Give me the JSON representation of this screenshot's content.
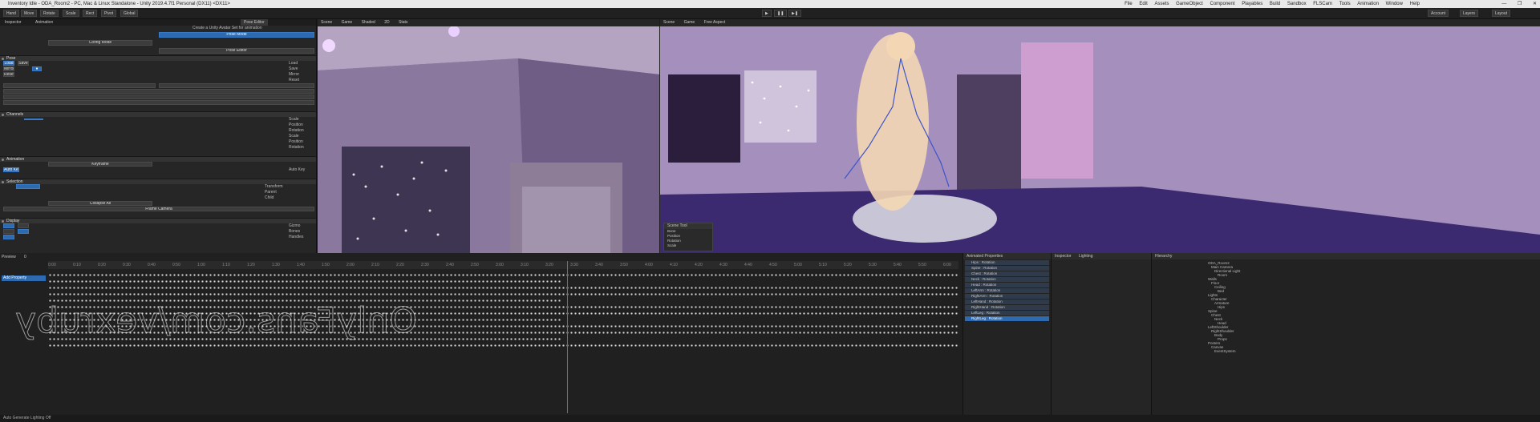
{
  "title_bar": {
    "title": "Inventory Idle - ODA_Room2 - PC, Mac & Linux Standalone - Unity 2019.4.7f1 Personal (DX11) <DX11>",
    "menus": [
      "File",
      "Edit",
      "Assets",
      "GameObject",
      "Component",
      "Playables",
      "Build",
      "Sandbox",
      "FLSCam",
      "Tools",
      "Animation",
      "Window",
      "Help"
    ],
    "window_controls": [
      "—",
      "❐",
      "✕"
    ]
  },
  "toolbar": {
    "tools": [
      "Hand",
      "Move",
      "Rotate",
      "Scale",
      "Rect"
    ],
    "pivot": "Pivot",
    "space": "Global",
    "account": "Account",
    "layers": "Layers",
    "layout": "Layout"
  },
  "left_panel": {
    "tabs": [
      "Inspector",
      "Animation",
      "Pose Editor"
    ],
    "header": "Create a Unity Avatar Set for animation",
    "buttons": [
      "Pose Mode",
      "Config Mode"
    ],
    "sections": [
      {
        "title": "Pose",
        "rows": [
          "Load",
          "Save",
          "Mirror",
          "Reset"
        ]
      },
      {
        "title": "Channels",
        "rows": [
          "Scale",
          "Position",
          "Rotation"
        ]
      },
      {
        "title": "Animation",
        "rows": [
          "Keyframe",
          "Auto Key"
        ]
      },
      {
        "title": "Selection",
        "rows": [
          "Transform",
          "Parent",
          "Child"
        ]
      },
      {
        "title": "Display",
        "rows": [
          "Gizmo",
          "Bones",
          "Handles"
        ]
      }
    ],
    "pose_editor_label": "Pose Editor",
    "collapse_label": "Collapse All",
    "frame_label": "Frame Camera"
  },
  "viewport_left": {
    "tabs": [
      "Scene",
      "Game"
    ],
    "shading": "Shaded",
    "mode": "2D",
    "stats": "Stats"
  },
  "viewport_right": {
    "tabs": [
      "Scene",
      "Game"
    ],
    "camera": "Free Aspect",
    "overlay_title": "Scene Tool",
    "overlay_rows": [
      "Bone",
      "Position",
      "Rotation",
      "Scale"
    ]
  },
  "timeline": {
    "preview_label": "Preview",
    "frame": "0",
    "ruler": [
      "0:00",
      "0:10",
      "0:20",
      "0:30",
      "0:40",
      "0:50",
      "1:00",
      "1:10",
      "1:20",
      "1:30",
      "1:40",
      "1:50",
      "2:00",
      "2:10",
      "2:20",
      "2:30",
      "2:40",
      "2:50",
      "3:00",
      "3:10",
      "3:20",
      "3:30",
      "3:40",
      "3:50",
      "4:00",
      "4:10",
      "4:20",
      "4:30",
      "4:40",
      "4:50",
      "5:00",
      "5:10",
      "5:20",
      "5:30",
      "5:40",
      "5:50",
      "6:00"
    ],
    "add_property": "Add Property"
  },
  "tracks": {
    "title": "Animated Properties",
    "items": [
      "Hips : Rotation",
      "Spine : Rotation",
      "Chest : Rotation",
      "Neck : Rotation",
      "Head : Rotation",
      "LeftArm : Rotation",
      "RightArm : Rotation",
      "LeftHand : Rotation",
      "RightHand : Rotation",
      "LeftLeg : Rotation",
      "RightLeg : Rotation"
    ]
  },
  "properties": {
    "title": "Inspector",
    "tabs": [
      "Inspector",
      "Lighting"
    ]
  },
  "hierarchy": {
    "title": "Hierarchy",
    "items": [
      "ODA_Room2",
      "Main Camera",
      "Directional Light",
      "Room",
      "Walls",
      "Floor",
      "Ceiling",
      "Bed",
      "Lights",
      "Character",
      "Armature",
      "Hips",
      "Spine",
      "Chest",
      "Neck",
      "Head",
      "LeftShoulder",
      "RightShoulder",
      "Body",
      "Props",
      "Posters",
      "Canvas",
      "EventSystem"
    ]
  },
  "watermark": "OnlyFans.com/vexruby",
  "status": "Auto Generate Lighting Off",
  "colors": {
    "accent": "#2d6ab0",
    "playhead": "#2e9a3a",
    "keyframe": "#d8d8d8"
  }
}
